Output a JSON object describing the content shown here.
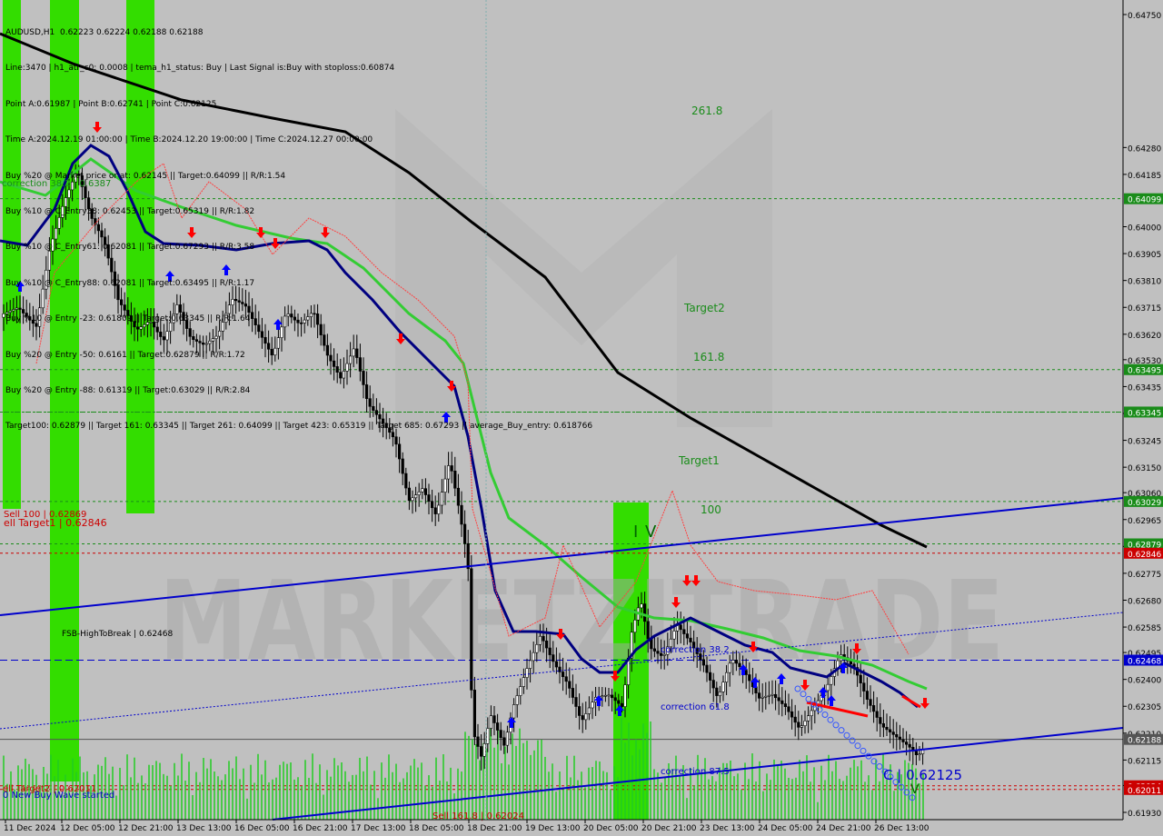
{
  "header": {
    "symbol_line": "AUDUSD,H1  0.62223 0.62224 0.62188 0.62188",
    "info_lines": [
      "Line:3470 | h1_atr_c0: 0.0008 | tema_h1_status: Buy | Last Signal is:Buy with stoploss:0.60874",
      "Point A:0.61987 | Point B:0.62741 | Point C:0.62125",
      "Time A:2024.12.19 01:00:00 | Time B:2024.12.20 19:00:00 | Time C:2024.12.27 00:00:00",
      "Buy %20 @ Market price or at: 0.62145 || Target:0.64099 || R/R:1.54",
      "Buy %10 @ C_Entry38: 0.62453 || Target:0.65319 || R/R:1.82",
      "Buy %10 @ C_Entry61: 0.62081 || Target:0.67293 || R/R:3.58",
      "Buy %10 @ C_Entry88: 0.62081 || Target:0.63495 || R/R:1.17",
      "Buy %10 @ Entry -23: 0.61809 || Target:0.63345 || R/R:1.64",
      "Buy %20 @ Entry -50: 0.6161 || Target:0.62879 || R/R:1.72",
      "Buy %20 @ Entry -88: 0.61319 || Target:0.63029 || R/R:2.84",
      "Target100: 0.62879 || Target 161: 0.63345 || Target 261: 0.64099 || Target 423: 0.65319 || Target 685: 0.67293 || average_Buy_entry: 0.618766"
    ]
  },
  "watermark": {
    "text": "MARKETZITRADE"
  },
  "chart_data": {
    "type": "line",
    "title": "AUDUSD,H1",
    "ylim": [
      0.61931,
      0.64783
    ],
    "y_ticks": [
      "0.64750",
      "0.64280",
      "0.64185",
      "0.64000",
      "0.63905",
      "0.63810",
      "0.63715",
      "0.63620",
      "0.63530",
      "0.63435",
      "0.63340",
      "0.63245",
      "0.63150",
      "0.63060",
      "0.62965",
      "0.62870",
      "0.62775",
      "0.62680",
      "0.62585",
      "0.62495",
      "0.62400",
      "0.62305",
      "0.62210",
      "0.62115",
      "0.62025",
      "0.61930"
    ],
    "x_ticks": [
      "11 Dec 2024",
      "12 Dec 05:00",
      "12 Dec 21:00",
      "13 Dec 13:00",
      "16 Dec 05:00",
      "16 Dec 21:00",
      "17 Dec 13:00",
      "18 Dec 05:00",
      "18 Dec 21:00",
      "19 Dec 13:00",
      "20 Dec 05:00",
      "20 Dec 21:00",
      "23 Dec 13:00",
      "24 Dec 05:00",
      "24 Dec 21:00",
      "26 Dec 13:00"
    ],
    "levels": [
      {
        "price": 0.64099,
        "label": "0.64099",
        "color": "#1a8c1a"
      },
      {
        "price": 0.63495,
        "label": "0.63495",
        "color": "#1a8c1a"
      },
      {
        "price": 0.63345,
        "label": "0.63345",
        "color": "#1a8c1a"
      },
      {
        "price": 0.63029,
        "label": "0.63029",
        "color": "#1a8c1a"
      },
      {
        "price": 0.62879,
        "label": "0.62879",
        "color": "#1a8c1a"
      },
      {
        "price": 0.62846,
        "label": "0.62846",
        "color": "#cc0000"
      },
      {
        "price": 0.62468,
        "label": "0.62468",
        "color": "#0000cc"
      },
      {
        "price": 0.62188,
        "label": "0.62188",
        "color": "#555555"
      },
      {
        "price": 0.62024,
        "label": "0.62024",
        "color": "#cc0000"
      },
      {
        "price": 0.62011,
        "label": "0.62011",
        "color": "#cc0000"
      }
    ],
    "annotations": [
      {
        "text": "261.8",
        "color": "#1a8c1a"
      },
      {
        "text": "Target2",
        "color": "#1a8c1a"
      },
      {
        "text": "161.8",
        "color": "#1a8c1a"
      },
      {
        "text": "Target1",
        "color": "#1a8c1a"
      },
      {
        "text": "100",
        "color": "#1a8c1a"
      },
      {
        "text": "Sell 100 | 0.62869",
        "color": "#cc0000"
      },
      {
        "text": "ell Target1 | 0.62846",
        "color": "#cc0000"
      },
      {
        "text": "correction 38.2 | 0.6387",
        "color": "#1a8c1a"
      },
      {
        "text": "FSB-HighToBreak | 0.62468",
        "color": "#000000"
      },
      {
        "text": "correction 38.2",
        "color": "#0000cc"
      },
      {
        "text": "correction 61.8",
        "color": "#0000cc"
      },
      {
        "text": "correction 87.5",
        "color": "#0000cc"
      },
      {
        "text": "C | 0.62125",
        "color": "#0000cc"
      },
      {
        "text": "Sell 161.8 | 0.62024",
        "color": "#cc0000"
      },
      {
        "text": "ell Target2 | 0.62011",
        "color": "#cc0000"
      },
      {
        "text": "0 New Buy Wave started",
        "color": "#0000cc"
      },
      {
        "text": "IV",
        "color": "#006600"
      },
      {
        "text": "V",
        "color": "#006600"
      }
    ],
    "last_price": 0.62188,
    "colors": {
      "background": "#c0c0c0",
      "ma_fast": "#000080",
      "ma_mid": "#33cc33",
      "ma_slow": "#000000",
      "channel": "#0000cc",
      "green_zone": "#33dd00",
      "sell_arrow": "#ff0000",
      "buy_arrow": "#0000ff"
    }
  }
}
